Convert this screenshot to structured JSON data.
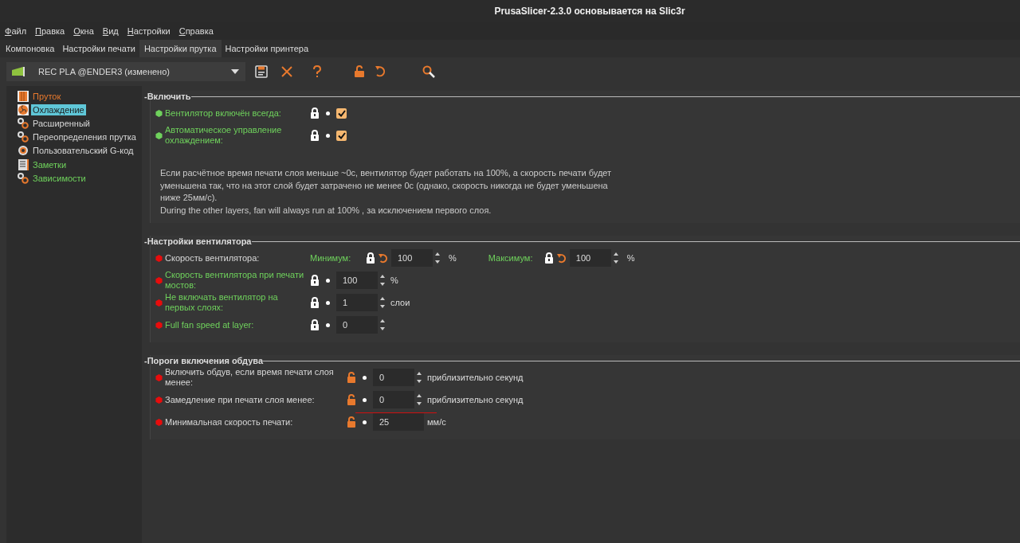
{
  "window": {
    "title": "PrusaSlicer-2.3.0 основывается на Slic3r"
  },
  "menu": [
    {
      "label": "Файл"
    },
    {
      "label": "Правка"
    },
    {
      "label": "Окна"
    },
    {
      "label": "Вид"
    },
    {
      "label": "Настройки"
    },
    {
      "label": "Справка"
    }
  ],
  "tabs": [
    {
      "label": "Компоновка",
      "selected": false
    },
    {
      "label": "Настройки печати",
      "selected": false
    },
    {
      "label": "Настройки прутка",
      "selected": true
    },
    {
      "label": "Настройки принтера",
      "selected": false
    }
  ],
  "preset": {
    "name": "REC PLA @ENDER3 (изменено)"
  },
  "sidebar": {
    "items": [
      {
        "label": "Пруток",
        "kind": "filament",
        "color": "#e8792d",
        "selected": false
      },
      {
        "label": "Охлаждение",
        "kind": "cooling",
        "selected": true
      },
      {
        "label": "Расширенный",
        "kind": "gears",
        "color": "#d8d8d8",
        "selected": false
      },
      {
        "label": "Переопределения прутка",
        "kind": "gears",
        "color": "#d8d8d8",
        "selected": false
      },
      {
        "label": "Пользовательский G-код",
        "kind": "gcode",
        "color": "#d8d8d8",
        "selected": false
      },
      {
        "label": "Заметки",
        "kind": "notes",
        "color": "#6fd25c",
        "selected": false
      },
      {
        "label": "Зависимости",
        "kind": "gears",
        "color": "#6fd25c",
        "selected": false
      }
    ]
  },
  "sections": [
    {
      "title": "-Включить",
      "options": [
        {
          "kind": "checkbox",
          "label": "Вентилятор включён всегда:",
          "color": "#6fd25c",
          "marker": {
            "color": "#6fd25c"
          },
          "locked": true,
          "modified": false,
          "checked": true
        },
        {
          "kind": "checkbox",
          "label": "Автоматическое управление охлаждением:",
          "color": "#6fd25c",
          "marker": {
            "color": "#6fd25c"
          },
          "locked": true,
          "modified": false,
          "checked": true
        }
      ],
      "note": [
        "Если расчётное время печати слоя меньше ~0с, вентилятор будет работать на 100%, а скорость печати будет уменьшена так, что на этот слой будет затрачено не менее 0с (однако, скорость никогда не будет уменьшена ниже 25мм/с).",
        "During the other layers, fan will always run at 100% , за исключением первого слоя."
      ]
    },
    {
      "title": "-Настройки вентилятора",
      "options": [
        {
          "kind": "dual",
          "label": "Скорость вентилятора:",
          "color": "#d8d8d8",
          "marker": {
            "color": "#e80c0c"
          },
          "fields": [
            {
              "label": "Минимум:",
              "locked": true,
              "modified": true,
              "value": "100",
              "unit": "%",
              "spin": true
            },
            {
              "label": "Максимум:",
              "locked": true,
              "modified": true,
              "value": "100",
              "unit": "%",
              "spin": true
            }
          ]
        },
        {
          "kind": "number",
          "label": "Скорость вентилятора при печати мостов:",
          "color": "#6fd25c",
          "marker": {
            "color": "#e80c0c"
          },
          "locked": true,
          "modified": false,
          "value": "100",
          "unit": "%",
          "spin": true
        },
        {
          "kind": "number",
          "label": "Не включать вентилятор на первых слоях:",
          "color": "#6fd25c",
          "marker": {
            "color": "#e80c0c"
          },
          "locked": true,
          "modified": false,
          "value": "1",
          "unit": "слои",
          "spin": true
        },
        {
          "kind": "number",
          "label": "Full fan speed at layer:",
          "color": "#6fd25c",
          "marker": {
            "color": "#e80c0c"
          },
          "locked": true,
          "modified": false,
          "value": "0",
          "spin": true
        }
      ]
    },
    {
      "title": "-Пороги включения обдува",
      "options": [
        {
          "kind": "number",
          "label": "Включить обдув, если время печати слоя менее:",
          "color": "#d8d8d8",
          "marker": {
            "color": "#e80c0c"
          },
          "locked": false,
          "modified": false,
          "value": "0",
          "unit": "приблизительно секунд",
          "spin": true
        },
        {
          "kind": "number",
          "label": "Замедление при печати слоя менее:",
          "color": "#d8d8d8",
          "marker": {
            "color": "#e80c0c"
          },
          "locked": false,
          "modified": false,
          "value": "0",
          "unit": "приблизительно секунд",
          "spin": true,
          "underlined": true
        },
        {
          "kind": "number",
          "label": "Минимальная скорость печати:",
          "color": "#d8d8d8",
          "marker": {
            "color": "#e80c0c"
          },
          "locked": false,
          "modified": false,
          "value": "25",
          "unit": "мм/с",
          "spin": false
        }
      ]
    }
  ]
}
